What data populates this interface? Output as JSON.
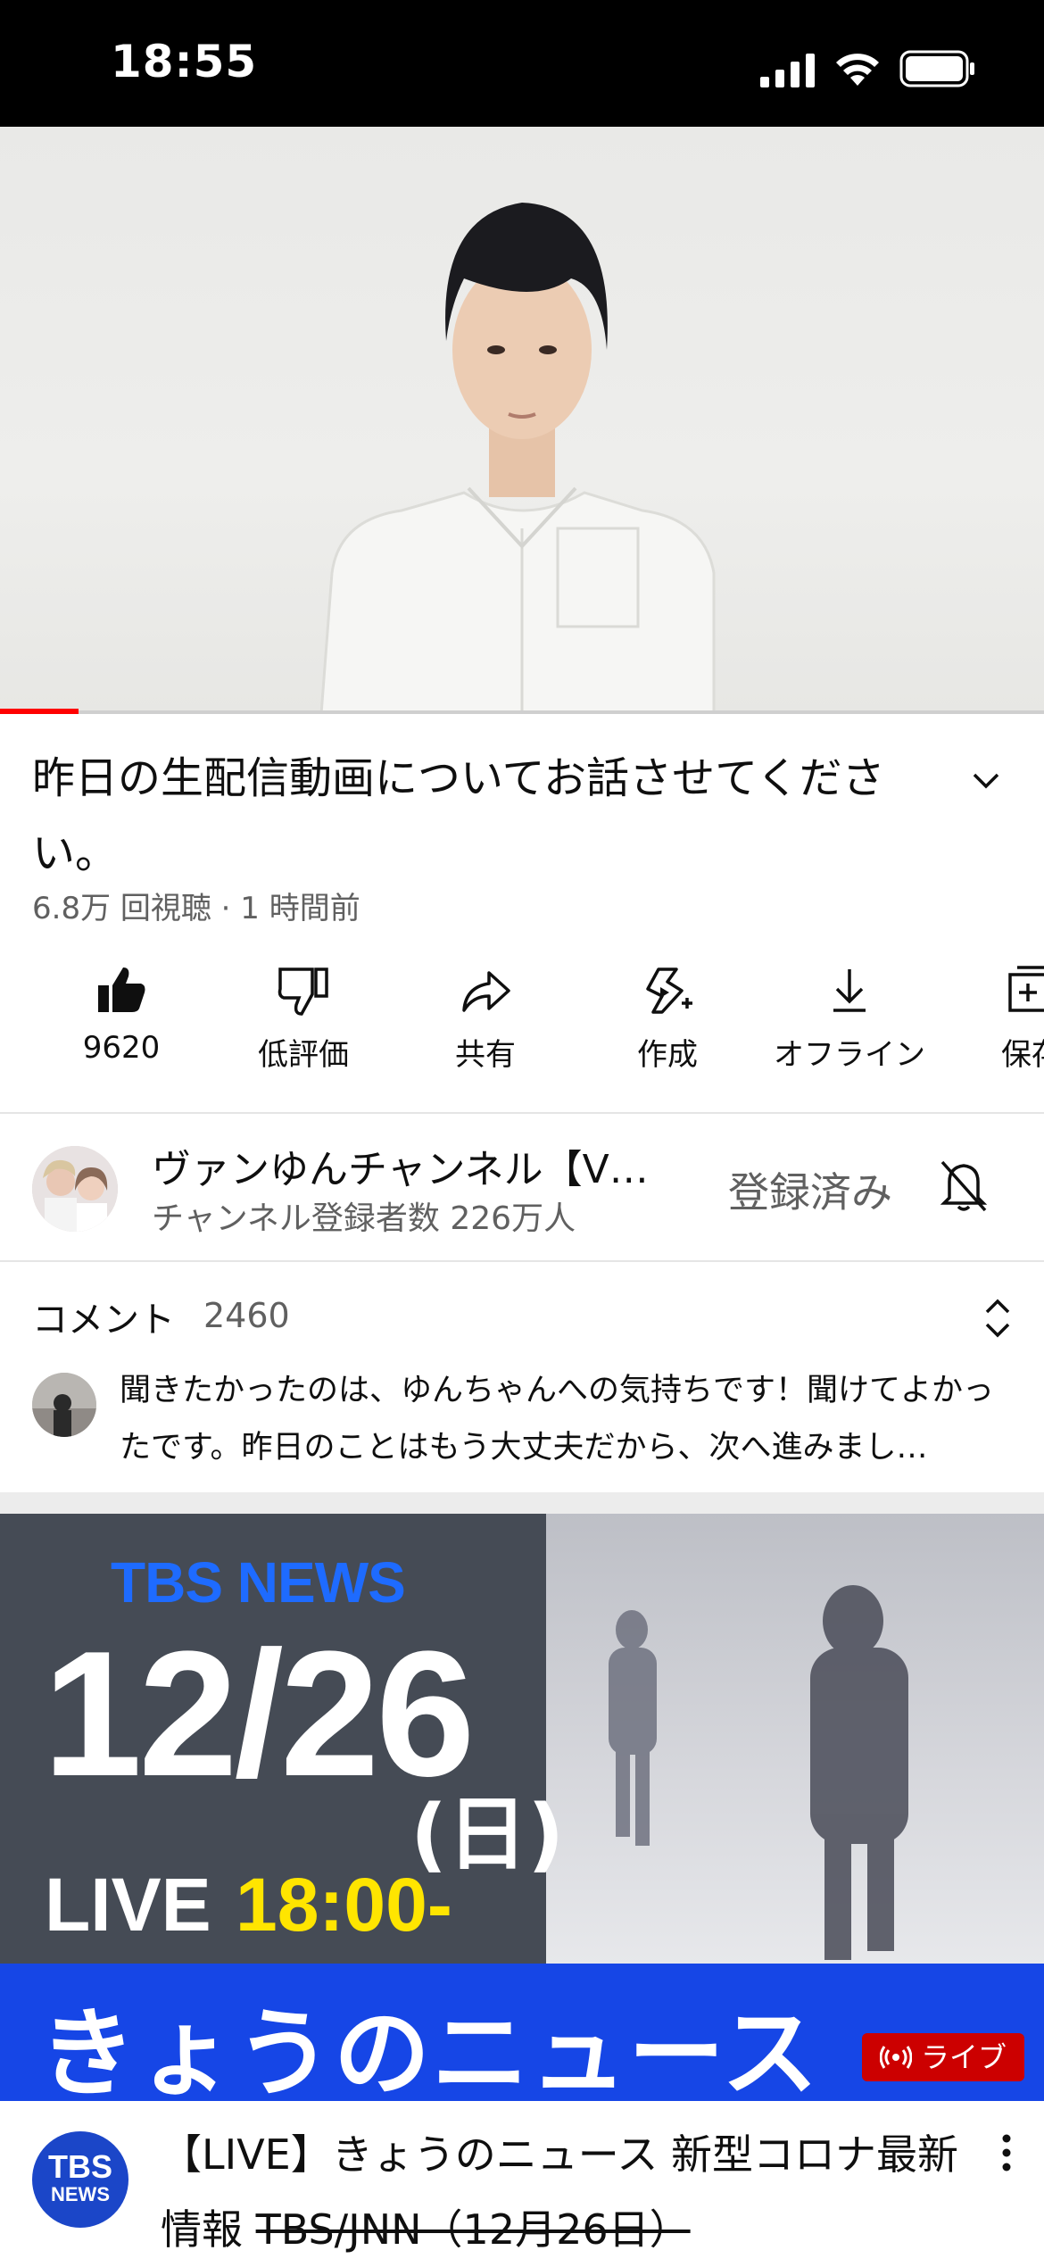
{
  "status_bar": {
    "time": "18:55"
  },
  "player": {
    "progress_fraction": 0.075,
    "progress_color": "#ff0000"
  },
  "video": {
    "title": "昨日の生配信動画についてお話させてください。",
    "meta": "6.8万 回視聴 · 1 時間前"
  },
  "actions": [
    {
      "label": "9620",
      "icon": "thumbs-up-icon"
    },
    {
      "label": "低評価",
      "icon": "thumbs-down-icon"
    },
    {
      "label": "共有",
      "icon": "share-icon"
    },
    {
      "label": "作成",
      "icon": "create-icon"
    },
    {
      "label": "オフライン",
      "icon": "download-icon"
    },
    {
      "label": "保存",
      "icon": "save-icon"
    }
  ],
  "channel": {
    "name": "ヴァンゆんチャンネル【V…",
    "subscribers": "チャンネル登録者数 226万人",
    "subscribe_state": "登録済み"
  },
  "comments": {
    "title": "コメント",
    "count": "2460",
    "top_comment": "聞きたかったのは、ゆんちゃんへの気持ちです！聞けてよかったです。昨日のことはもう大丈夫だから、次へ進みまし…"
  },
  "next_video": {
    "thumbnail": {
      "brand": "TBS NEWS",
      "date": "12/26",
      "day": "(日)",
      "live_word": "LIVE",
      "live_time": "18:00-",
      "headline": "きょうのニュース",
      "badge": "ライブ"
    },
    "channel_logo_top": "TBS",
    "channel_logo_bottom": "NEWS",
    "title_part1": "【LIVE】きょうのニュース 新型コロナ最新情報 ",
    "title_part2": "TBS/JNN（12月26日）"
  }
}
